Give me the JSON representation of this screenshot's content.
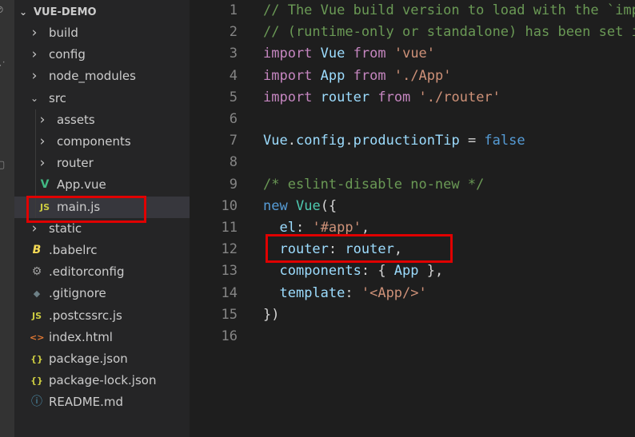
{
  "explorer": {
    "root_label": "VUE-DEMO",
    "items": [
      {
        "label": "build",
        "kind": "folder",
        "expanded": false,
        "depth": 1
      },
      {
        "label": "config",
        "kind": "folder",
        "expanded": false,
        "depth": 1
      },
      {
        "label": "node_modules",
        "kind": "folder",
        "expanded": false,
        "depth": 1
      },
      {
        "label": "src",
        "kind": "folder",
        "expanded": true,
        "depth": 1
      },
      {
        "label": "assets",
        "kind": "folder",
        "expanded": false,
        "depth": 2
      },
      {
        "label": "components",
        "kind": "folder",
        "expanded": false,
        "depth": 2
      },
      {
        "label": "router",
        "kind": "folder",
        "expanded": false,
        "depth": 2
      },
      {
        "label": "App.vue",
        "kind": "vue",
        "depth": 2
      },
      {
        "label": "main.js",
        "kind": "js",
        "depth": 2,
        "selected": true
      },
      {
        "label": "static",
        "kind": "folder",
        "expanded": false,
        "depth": 1
      },
      {
        "label": ".babelrc",
        "kind": "babel",
        "depth": 1
      },
      {
        "label": ".editorconfig",
        "kind": "gear",
        "depth": 1
      },
      {
        "label": ".gitignore",
        "kind": "git",
        "depth": 1
      },
      {
        "label": ".postcssrc.js",
        "kind": "js",
        "depth": 1
      },
      {
        "label": "index.html",
        "kind": "html",
        "depth": 1
      },
      {
        "label": "package.json",
        "kind": "json",
        "depth": 1
      },
      {
        "label": "package-lock.json",
        "kind": "json",
        "depth": 1
      },
      {
        "label": "README.md",
        "kind": "info",
        "depth": 1
      }
    ]
  },
  "icons": {
    "chevron_right": "›",
    "chevron_down": "⌄",
    "vue": "V",
    "js": "JS",
    "babel": "B",
    "gear": "⚙",
    "git": "◆",
    "html": "<>",
    "json": "{}",
    "info": "ⓘ"
  },
  "colors": {
    "vue": "#41b883",
    "js": "#cbcb41",
    "babel": "#f5da55",
    "gear": "#a0a0a0",
    "git": "#6d8086",
    "html": "#e37933",
    "json": "#cbcb41",
    "info": "#519aba",
    "highlight": "#e00000"
  },
  "editor": {
    "lines": [
      {
        "n": "1",
        "tokens": [
          [
            "// The Vue build version to load with the `import` command",
            "comment"
          ]
        ]
      },
      {
        "n": "2",
        "tokens": [
          [
            "// (runtime-only or standalone) has been set in webpack.base.conf with an alias.",
            "comment"
          ]
        ]
      },
      {
        "n": "3",
        "tokens": [
          [
            "import",
            "kw"
          ],
          [
            " ",
            "plain"
          ],
          [
            "Vue",
            "var"
          ],
          [
            " ",
            "plain"
          ],
          [
            "from",
            "kw"
          ],
          [
            " ",
            "plain"
          ],
          [
            "'vue'",
            "str"
          ]
        ]
      },
      {
        "n": "4",
        "tokens": [
          [
            "import",
            "kw"
          ],
          [
            " ",
            "plain"
          ],
          [
            "App",
            "var"
          ],
          [
            " ",
            "plain"
          ],
          [
            "from",
            "kw"
          ],
          [
            " ",
            "plain"
          ],
          [
            "'./App'",
            "str"
          ]
        ]
      },
      {
        "n": "5",
        "tokens": [
          [
            "import",
            "kw"
          ],
          [
            " ",
            "plain"
          ],
          [
            "router",
            "var"
          ],
          [
            " ",
            "plain"
          ],
          [
            "from",
            "kw"
          ],
          [
            " ",
            "plain"
          ],
          [
            "'./router'",
            "str"
          ]
        ]
      },
      {
        "n": "6",
        "tokens": []
      },
      {
        "n": "7",
        "tokens": [
          [
            "Vue",
            "var"
          ],
          [
            ".",
            "plain"
          ],
          [
            "config",
            "var"
          ],
          [
            ".",
            "plain"
          ],
          [
            "productionTip",
            "var"
          ],
          [
            " = ",
            "plain"
          ],
          [
            "false",
            "blue"
          ]
        ]
      },
      {
        "n": "8",
        "tokens": []
      },
      {
        "n": "9",
        "tokens": [
          [
            "/* eslint-disable no-new */",
            "comment"
          ]
        ]
      },
      {
        "n": "10",
        "tokens": [
          [
            "new",
            "blue"
          ],
          [
            " ",
            "plain"
          ],
          [
            "Vue",
            "cls"
          ],
          [
            "({",
            "plain"
          ]
        ]
      },
      {
        "n": "11",
        "tokens": [
          [
            "  ",
            "plain"
          ],
          [
            "el",
            "var"
          ],
          [
            ": ",
            "plain"
          ],
          [
            "'#app'",
            "str"
          ],
          [
            ",",
            "plain"
          ]
        ]
      },
      {
        "n": "12",
        "tokens": [
          [
            "  ",
            "plain"
          ],
          [
            "router",
            "var"
          ],
          [
            ": ",
            "plain"
          ],
          [
            "router",
            "var"
          ],
          [
            ",",
            "plain"
          ]
        ]
      },
      {
        "n": "13",
        "tokens": [
          [
            "  ",
            "plain"
          ],
          [
            "components",
            "var"
          ],
          [
            ": { ",
            "plain"
          ],
          [
            "App",
            "var"
          ],
          [
            " },",
            "plain"
          ]
        ]
      },
      {
        "n": "14",
        "tokens": [
          [
            "  ",
            "plain"
          ],
          [
            "template",
            "var"
          ],
          [
            ": ",
            "plain"
          ],
          [
            "'<App/>'",
            "str"
          ]
        ]
      },
      {
        "n": "15",
        "tokens": [
          [
            "})",
            "plain"
          ]
        ]
      },
      {
        "n": "16",
        "tokens": []
      }
    ]
  }
}
